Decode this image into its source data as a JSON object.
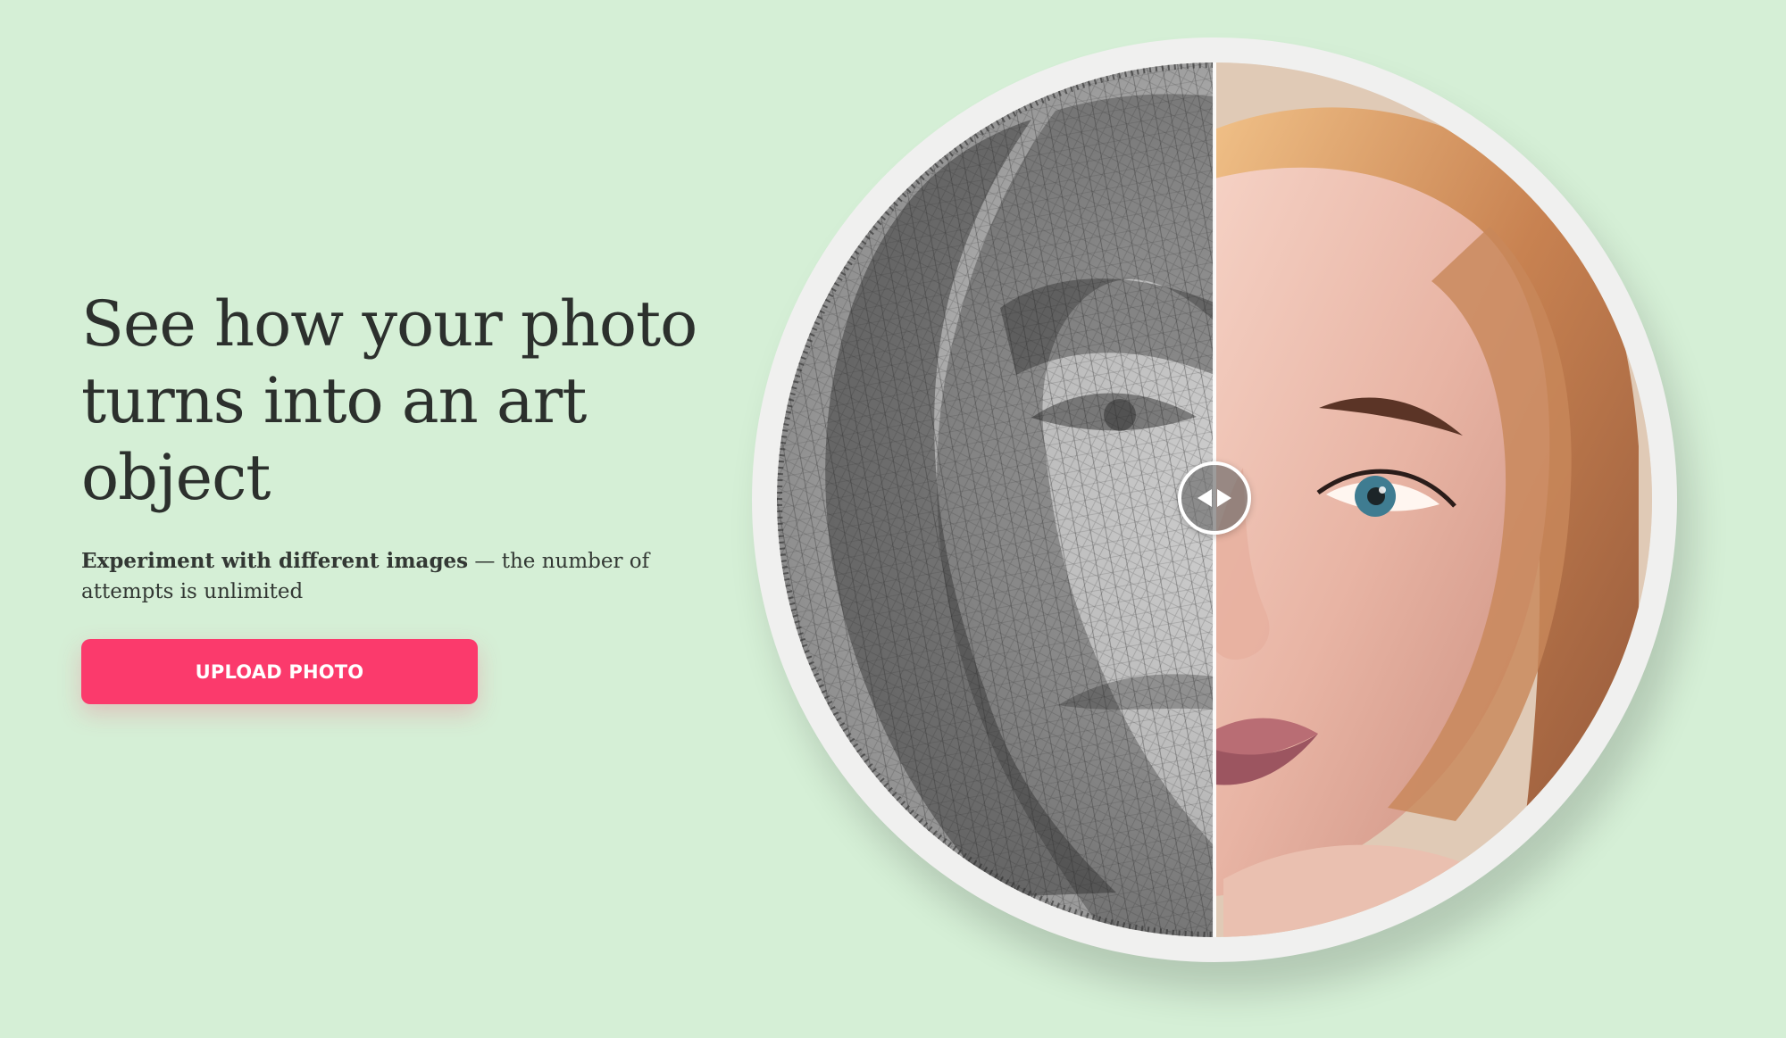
{
  "hero": {
    "title_lines": [
      "See how your photo",
      "turns into an art",
      "object"
    ],
    "subtext_bold": "Experiment with different images",
    "subtext_rest": " — the number of attempts is unlimited",
    "button_label": "UPLOAD PHOTO"
  },
  "compare": {
    "left_image": "string-art-portrait-left-half",
    "right_image": "original-photo-right-half",
    "handle_icon": "left-right-arrows-icon",
    "split_percent": 50
  },
  "colors": {
    "background": "#d5efd6",
    "text": "#2c302d",
    "button": "#fb3a6c",
    "button_text": "#ffffff",
    "frame": "#f0f0ef"
  }
}
